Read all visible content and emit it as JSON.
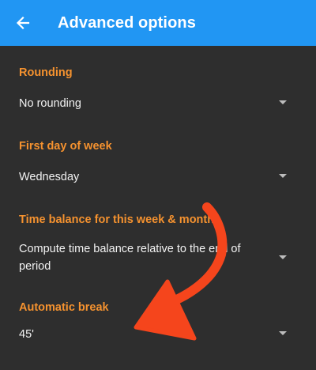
{
  "app_bar": {
    "back_icon": "arrow-left-icon",
    "title": "Advanced options",
    "color": "#2196f3"
  },
  "accent_color": "#f5922f",
  "settings": [
    {
      "label": "Rounding",
      "value": "No rounding"
    },
    {
      "label": "First day of week",
      "value": "Wednesday"
    },
    {
      "label": "Time balance for this week & month",
      "value": "Compute time balance relative to the end of period"
    },
    {
      "label": "Automatic break",
      "value": "45'"
    }
  ],
  "annotation": {
    "icon": "hand-drawn-curved-arrow-icon",
    "color": "#f5451c"
  }
}
